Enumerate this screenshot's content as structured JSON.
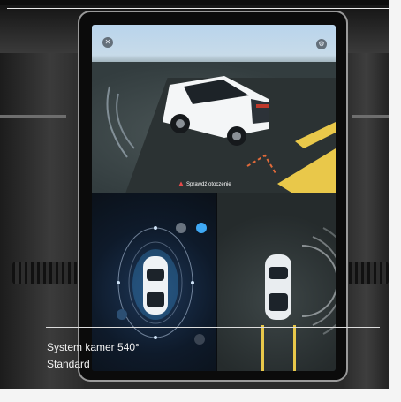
{
  "screen": {
    "warning_text": "Sprawdź otoczenie",
    "close_icon": "close-icon",
    "settings_icon": "settings-icon"
  },
  "caption": {
    "title": "System kamer 540°",
    "subtitle": "Standard"
  },
  "colors": {
    "parking_line": "#e9c84a",
    "accent": "#3fa9f5"
  }
}
